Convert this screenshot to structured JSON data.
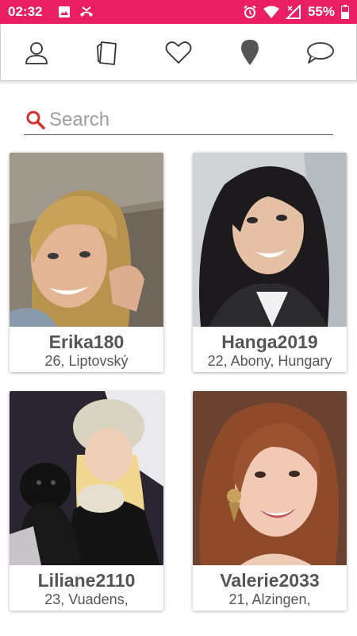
{
  "status_bar": {
    "time": "02:32",
    "battery": "55%",
    "color": "#e91e63"
  },
  "nav": {
    "items": [
      "profile-icon",
      "cards-icon",
      "heart-icon",
      "location-icon",
      "chat-icon"
    ]
  },
  "search": {
    "placeholder": "Search",
    "value": ""
  },
  "profiles": [
    {
      "name": "Erika180",
      "details": "26, Liptovský"
    },
    {
      "name": "Hanga2019",
      "details": "22, Abony, Hungary"
    },
    {
      "name": "Liliane2110",
      "details": "23, Vuadens,"
    },
    {
      "name": "Valerie2033",
      "details": "21, Alzingen,"
    }
  ],
  "colors": {
    "accent": "#e91e63",
    "search_icon": "#d32f2f",
    "text": "#555555"
  }
}
